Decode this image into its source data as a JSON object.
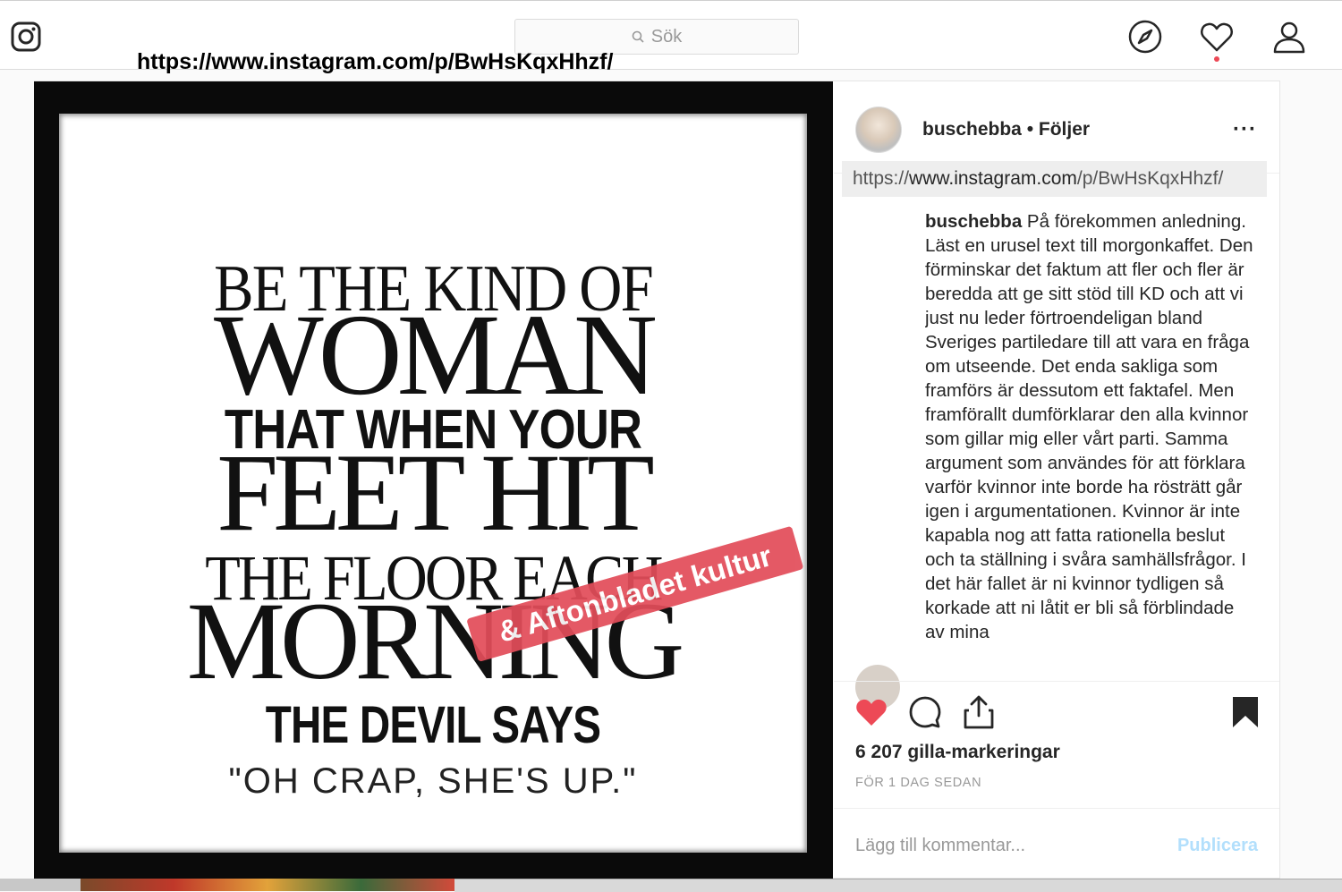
{
  "top_nav": {
    "search_placeholder": "Sök",
    "url_overlay": "https://www.instagram.com/p/BwHsKqxHhzf/",
    "icons": [
      "instagram-logo-icon",
      "explore-compass-icon",
      "activity-heart-icon",
      "profile-icon"
    ],
    "notification_dot_color": "#ed4956"
  },
  "media": {
    "quote_lines": [
      "BE THE KIND OF",
      "WOMAN",
      "THAT WHEN YOUR",
      "FEET HIT",
      "THE FLOOR EACH",
      "MORNING",
      "THE DEVIL SAYS",
      "\"OH CRAP, SHE'S UP.\""
    ],
    "sticker": "& Aftonbladet kultur",
    "sticker_color": "#e24d5a"
  },
  "post": {
    "username": "buschebba",
    "follow_status": "• Följer",
    "more_label": "···",
    "link_prefix": "https://",
    "link_host": "www.instagram.com",
    "link_path": "/p/BwHsKqxHhzf/",
    "caption_username": "buschebba",
    "caption_text": "På förekommen anledning. Läst en urusel text till morgonkaffet. Den förminskar det faktum att fler och fler är beredda att ge sitt stöd till KD och att vi just nu leder förtroendeligan bland Sveriges partiledare till att vara en fråga om utseende. Det enda sakliga som framförs är dessutom ett faktafel. Men framförallt dumförklarar den alla kvinnor som gillar mig eller vårt parti. Samma argument som användes för att förklara varför kvinnor inte borde ha rösträtt går igen i argumentationen. Kvinnor är inte kapabla nog att fatta rationella beslut och ta ställning i svåra samhällsfrågor. I det här fallet är ni kvinnor tydligen så korkade att ni låtit er bli så förblindade av mina",
    "likes": "6 207 gilla-markeringar",
    "timestamp": "FÖR 1 DAG SEDAN",
    "comment_placeholder": "Lägg till kommentar...",
    "publish_label": "Publicera",
    "like_color": "#ed4956",
    "publish_color": "#b2dffc"
  }
}
